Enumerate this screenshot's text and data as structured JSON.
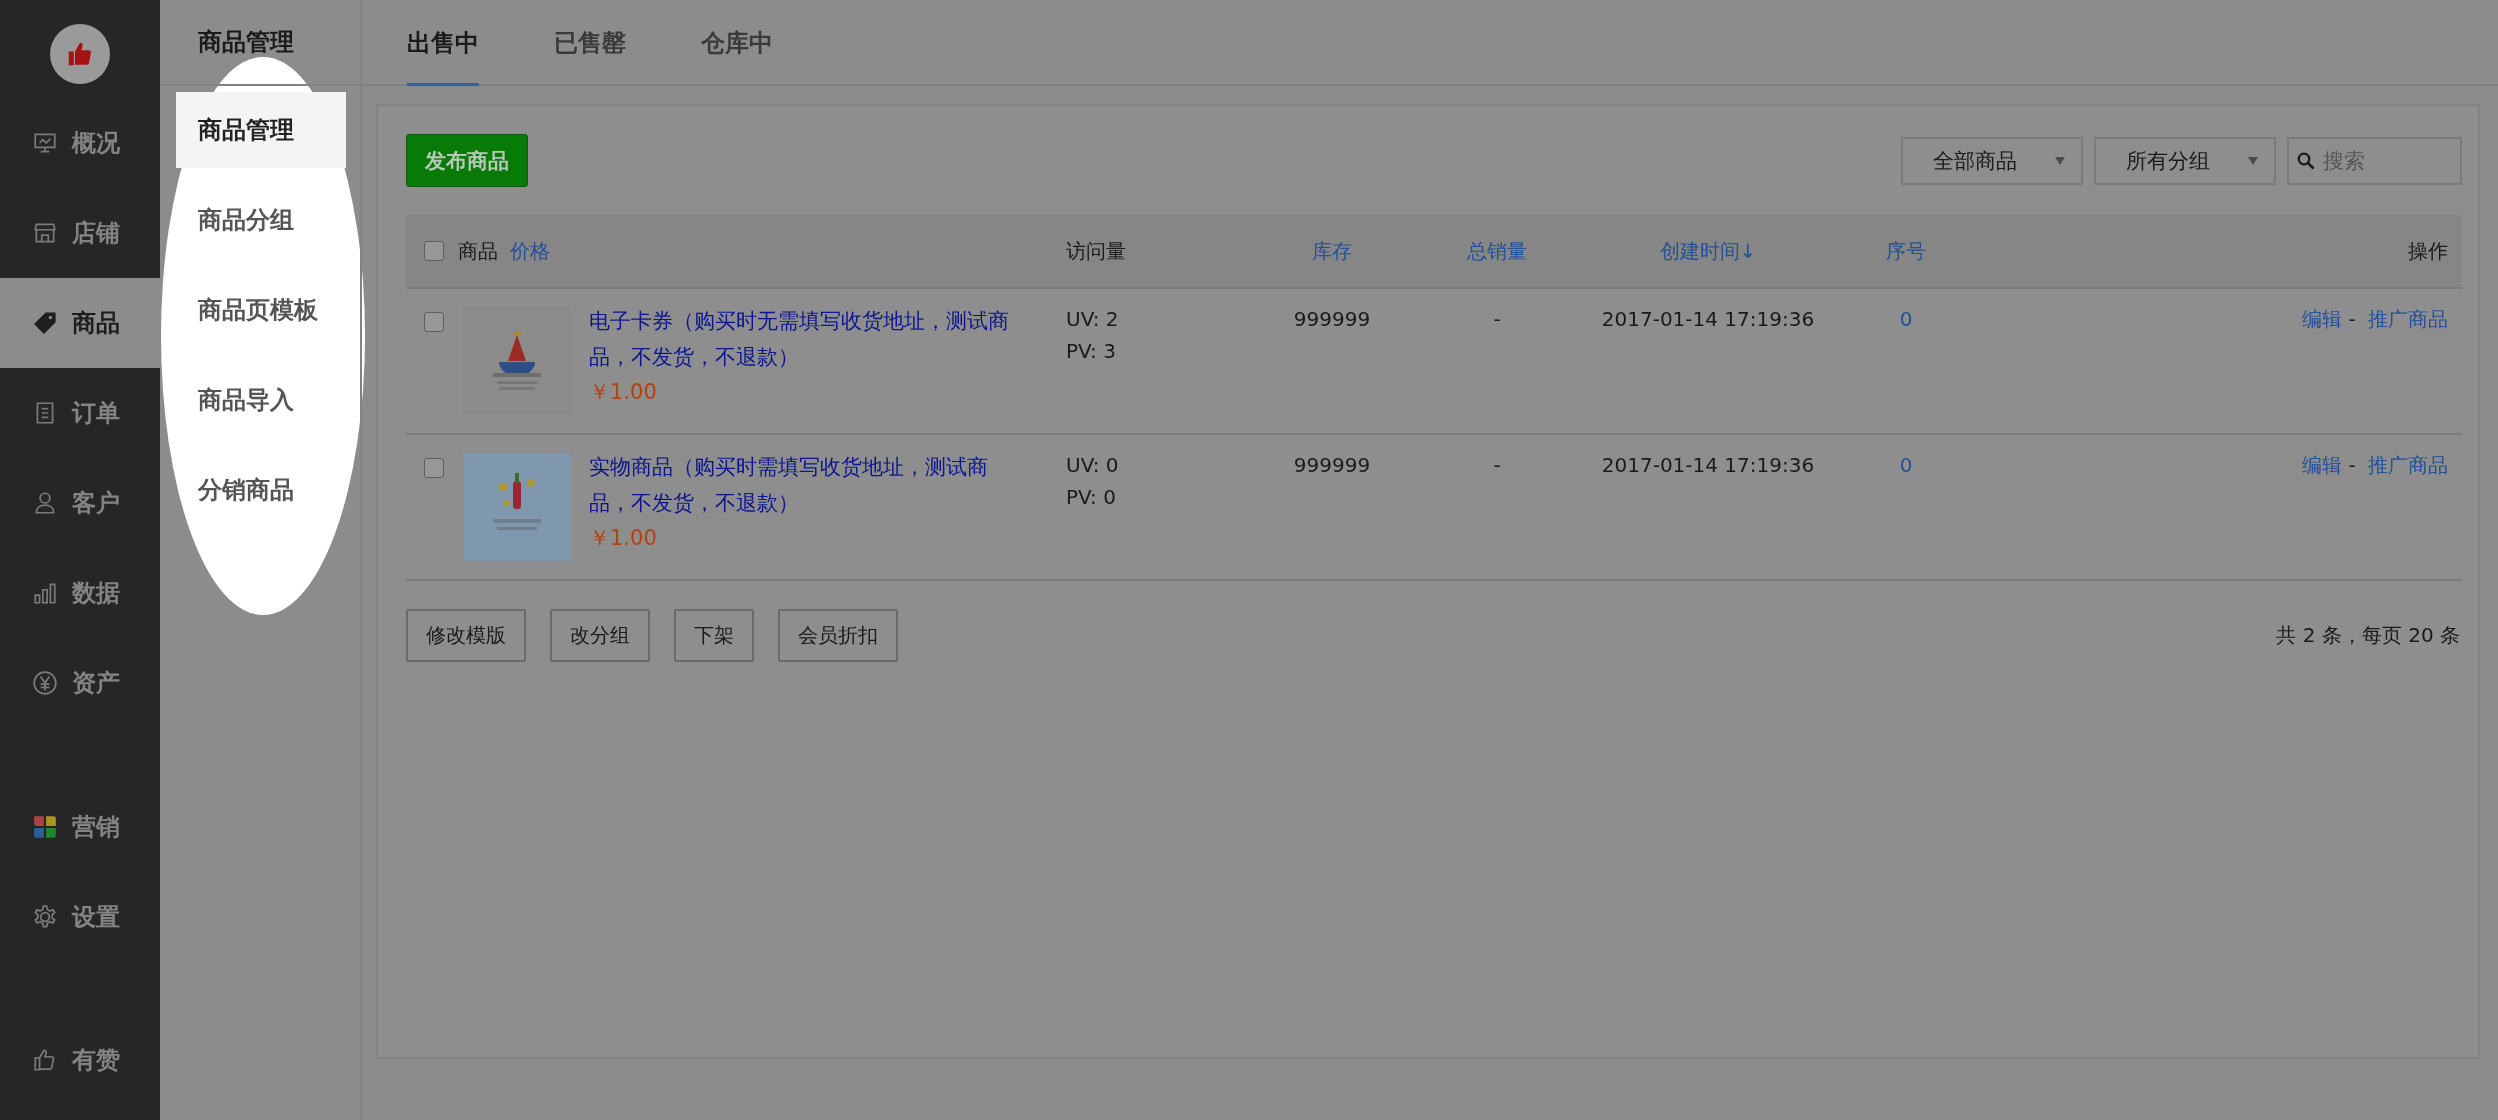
{
  "sidebar": {
    "sections": [
      {
        "items": [
          {
            "label": "概况",
            "selected": false
          },
          {
            "label": "店铺",
            "selected": false
          },
          {
            "label": "商品",
            "selected": true
          },
          {
            "label": "订单",
            "selected": false
          },
          {
            "label": "客户",
            "selected": false
          },
          {
            "label": "数据",
            "selected": false
          },
          {
            "label": "资产",
            "selected": false
          }
        ]
      },
      {
        "items": [
          {
            "label": "营销",
            "selected": false
          },
          {
            "label": "设置",
            "selected": false
          }
        ]
      },
      {
        "items": [
          {
            "label": "有赞",
            "selected": false
          }
        ]
      }
    ]
  },
  "secondary_nav": {
    "title": "商品管理",
    "items": [
      {
        "label": "商品管理",
        "selected": true
      },
      {
        "label": "商品分组",
        "selected": false
      },
      {
        "label": "商品页模板",
        "selected": false
      },
      {
        "label": "商品导入",
        "selected": false
      },
      {
        "label": "分销商品",
        "selected": false
      }
    ]
  },
  "tabs": [
    {
      "label": "出售中",
      "selected": true
    },
    {
      "label": "已售罄",
      "selected": false
    },
    {
      "label": "仓库中",
      "selected": false
    }
  ],
  "publish_button": "发布商品",
  "filters": [
    {
      "label": "全部商品"
    },
    {
      "label": "所有分组"
    }
  ],
  "search": {
    "placeholder": "搜索"
  },
  "table": {
    "select_all_checked": false,
    "columns": [
      {
        "label": "商品",
        "link": false
      },
      {
        "label": "价格",
        "link": true
      },
      {
        "label": "访问量",
        "link": false
      },
      {
        "label": "库存",
        "link": true
      },
      {
        "label": "总销量",
        "link": true
      },
      {
        "label": "创建时间↓",
        "link": true
      },
      {
        "label": "序号",
        "link": true
      },
      {
        "label": "操作",
        "link": false
      }
    ],
    "rows": [
      {
        "checked": false,
        "title": "电子卡券（购买时无需填写收货地址，测试商品，不发货，不退款）",
        "price": "￥1.00",
        "uv": "UV: 2",
        "pv": "PV: 3",
        "stock": "999999",
        "sales": "-",
        "created": "2017-01-14 17:19:36",
        "order": "0",
        "separator": "-",
        "actions": [
          "编辑",
          "推广商品"
        ]
      },
      {
        "checked": false,
        "title": "实物商品（购买时需填写收货地址，测试商品，不发货，不退款）",
        "price": "￥1.00",
        "uv": "UV: 0",
        "pv": "PV: 0",
        "stock": "999999",
        "sales": "-",
        "created": "2017-01-14 17:19:36",
        "order": "0",
        "separator": "-",
        "actions": [
          "编辑",
          "推广商品"
        ]
      }
    ]
  },
  "bulk_actions": [
    "修改模版",
    "改分组",
    "下架",
    "会员折扣"
  ],
  "pagination": "共 2 条，每页 20 条"
}
